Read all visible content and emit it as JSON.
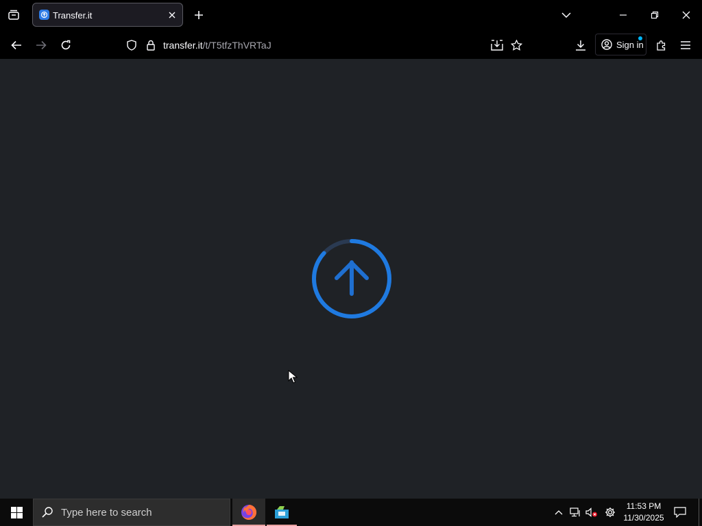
{
  "browser": {
    "tab": {
      "title": "Transfer.it",
      "favicon": "transfer-it-icon"
    },
    "url": {
      "host": "transfer.it",
      "path": "/t/T5tfzThVRTaJ"
    },
    "signin_label": "Sign in",
    "accent_color": "#2d7be5"
  },
  "page": {
    "upload_animation": {
      "icon": "upload-arrow-icon",
      "color": "#1f7ae0"
    }
  },
  "taskbar": {
    "search_placeholder": "Type here to search",
    "apps": [
      "firefox",
      "file-manager"
    ],
    "clock": {
      "time": "11:53 PM",
      "date": "11/30/2025"
    }
  }
}
